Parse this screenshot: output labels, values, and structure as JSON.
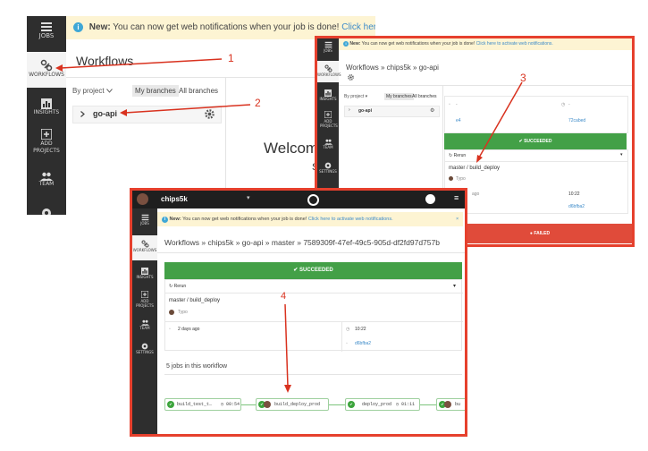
{
  "sidebar": {
    "jobs": "JOBS",
    "workflows": "WORKFLOWS",
    "insights": "INSIGHTS",
    "add_projects": "ADD PROJECTS",
    "team": "TEAM",
    "settings": "SETTINGS"
  },
  "banner": {
    "info_glyph": "i",
    "new_label": "New:",
    "text": "You can now get web notifications when your job is done!",
    "link": "Click here to activate",
    "link_full": "Click here to activate web notifications.",
    "close": "×"
  },
  "panel1": {
    "title": "Workflows",
    "filter_label": "By project",
    "tab_my": "My branches",
    "tab_all": "All branches",
    "project": "go-api",
    "welcome": "Welcom",
    "welcome_sub": "S"
  },
  "panel2": {
    "crumbs": [
      "Workflows",
      "chips5k",
      "go-api"
    ],
    "filter_label": "By project",
    "tab_my": "My branches",
    "tab_all": "All branches",
    "project": "go-api",
    "dash1": "-",
    "dash2": "-",
    "hash_short": "e4",
    "hash_right": "72cabed",
    "status_success": "SUCCEEDED",
    "rerun": "Rerun",
    "job": "master / build_deploy",
    "author": "Typo",
    "ago": "ago",
    "time": "10:22",
    "commit": "d6bfba2",
    "status_failed": "FAILED"
  },
  "panel3": {
    "user": "chips5k",
    "crumbs": [
      "Workflows",
      "chips5k",
      "go-api",
      "master",
      "7589309f-47ef-49c5-905d-df2fd97d757b"
    ],
    "status_success": "SUCCEEDED",
    "rerun": "Rerun",
    "job": "master / build_deploy",
    "author": "Typo",
    "date": "2 days ago",
    "time": "10:22",
    "commit": "d6bfba2",
    "jobs_heading": "5 jobs in this workflow",
    "nodes": [
      {
        "name": "build_test_t…",
        "time": "00:54"
      },
      {
        "name": "build_deploy_prod",
        "time": ""
      },
      {
        "name": "deploy_prod",
        "time": "01:11"
      },
      {
        "name": "bu",
        "time": ""
      }
    ]
  },
  "annotations": [
    "1",
    "2",
    "3",
    "4"
  ],
  "colors": {
    "sidebar": "#2e2e2e",
    "accent_red": "#e6402d",
    "success": "#43a047",
    "failed": "#e04b3a",
    "banner": "#fdf4d3",
    "link": "#3d8bc9"
  }
}
